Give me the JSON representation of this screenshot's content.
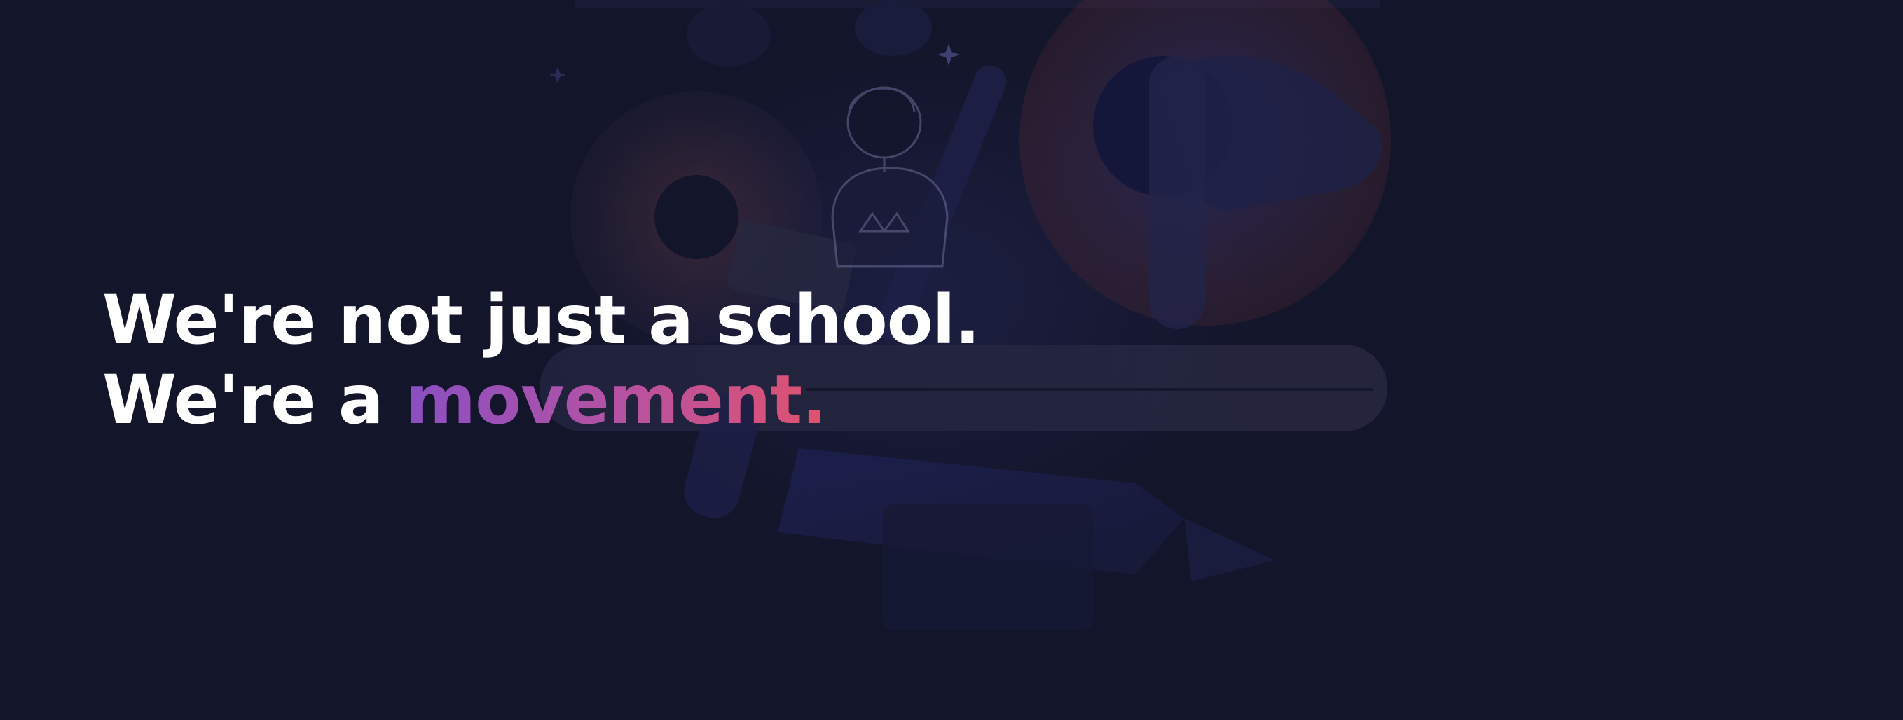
{
  "hero": {
    "headline_line1": "We're not just a school.",
    "headline_line2_prefix": "We're a ",
    "headline_line2_accent": "movement.",
    "illustration_name": "student-with-laptop-on-giant-magnet-illustration"
  },
  "colors": {
    "background": "#13152a",
    "headline_text": "#ffffff",
    "accent_gradient_start": "#8a4fc2",
    "accent_gradient_mid": "#b552a3",
    "accent_gradient_end": "#e0526e"
  }
}
